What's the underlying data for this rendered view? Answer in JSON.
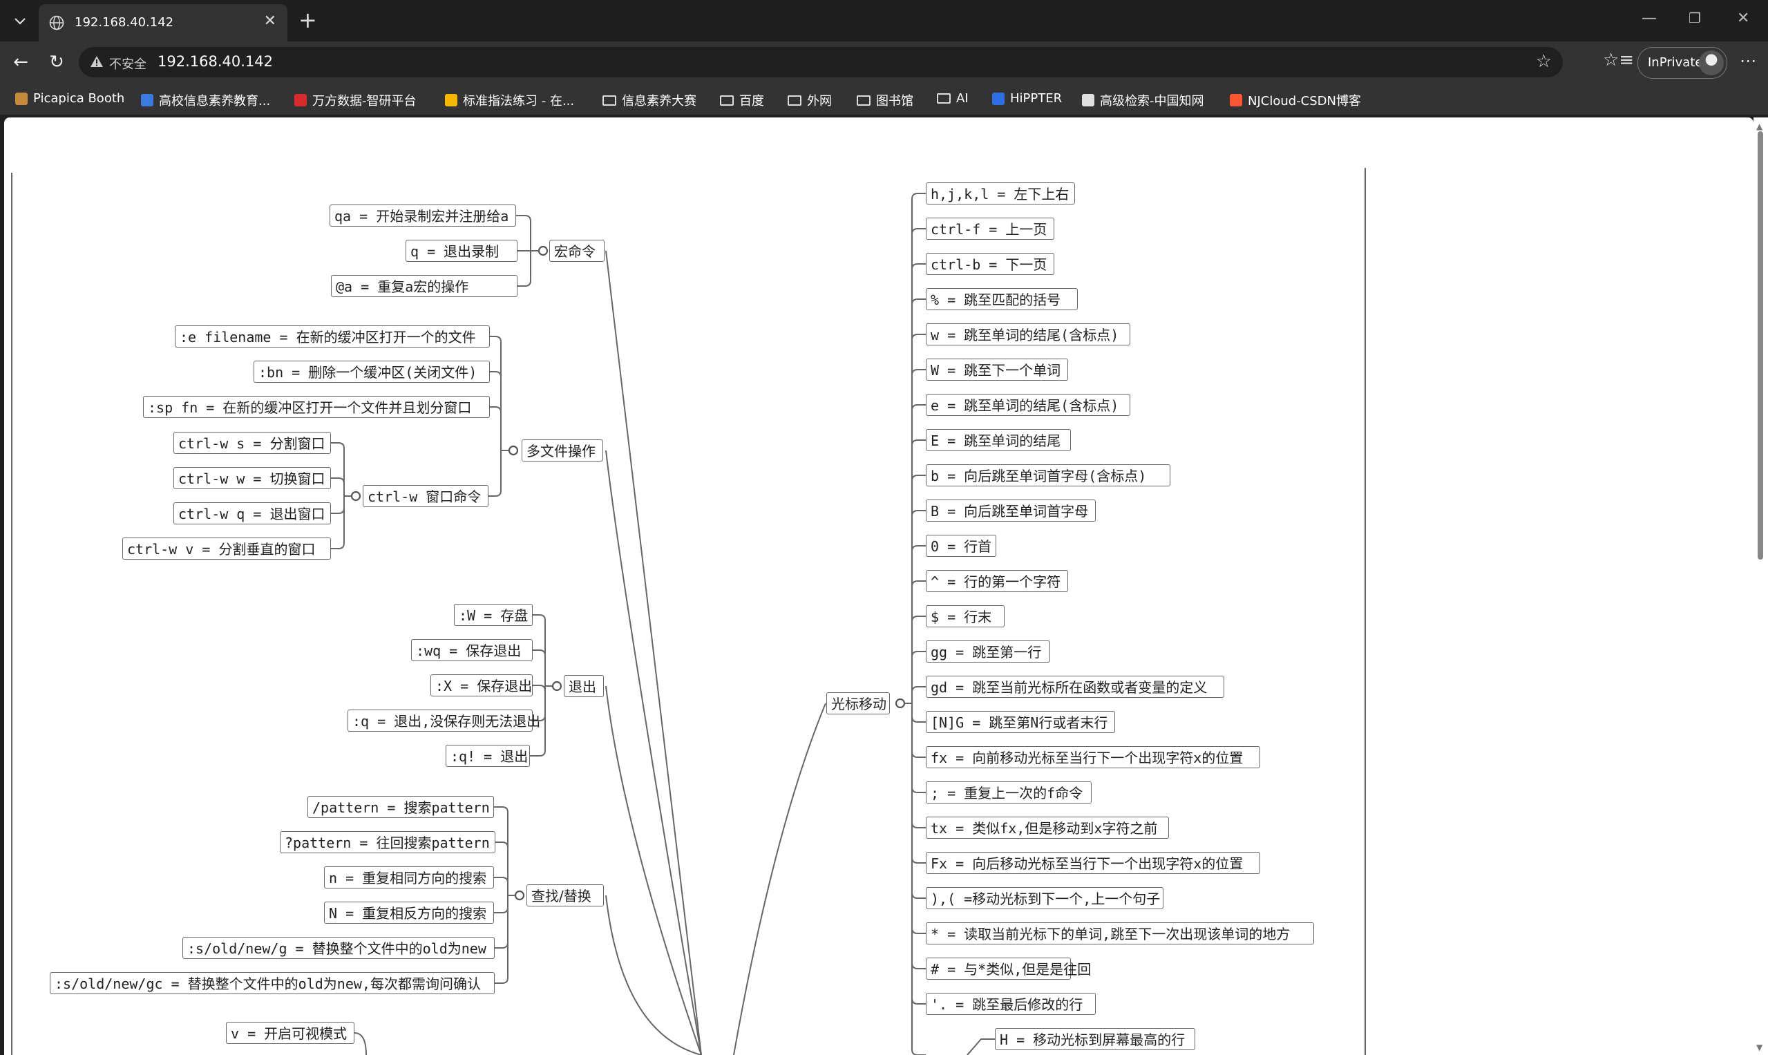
{
  "browser": {
    "tab_title": "192.168.40.142",
    "address_insecure_label": "不安全",
    "address_url": "192.168.40.142",
    "inprivate_label": "InPrivate",
    "bookmarks": [
      {
        "label": "Picapica Booth",
        "icon": "picapica-icon",
        "color": "#c68a3a"
      },
      {
        "label": "高校信息素养教育...",
        "icon": "z-logo-icon",
        "color": "#3b7be0"
      },
      {
        "label": "万方数据-智研平台",
        "icon": "wanfang-icon",
        "color": "#d92b2b"
      },
      {
        "label": "标准指法练习 - 在...",
        "icon": "emoji-icon",
        "color": "#f5b700"
      },
      {
        "label": "信息素养大赛",
        "icon": "folder-icon",
        "color": ""
      },
      {
        "label": "百度",
        "icon": "folder-icon",
        "color": ""
      },
      {
        "label": "外网",
        "icon": "folder-icon",
        "color": ""
      },
      {
        "label": "图书馆",
        "icon": "folder-icon",
        "color": ""
      },
      {
        "label": "AI",
        "icon": "folder-icon",
        "color": ""
      },
      {
        "label": "HiPPTER",
        "icon": "p-logo-icon",
        "color": "#2f6fe4"
      },
      {
        "label": "高级检索-中国知网",
        "icon": "cnki-icon",
        "color": "#e0e0e0"
      },
      {
        "label": "NJCloud-CSDN博客",
        "icon": "csdn-icon",
        "color": "#fc5531"
      }
    ]
  },
  "mindmap": {
    "groups": {
      "macro": "宏命令",
      "multifile": "多文件操作",
      "window": "ctrl-w 窗口命令",
      "quit": "退出",
      "search": "查找/替换",
      "cursor": "光标移动"
    },
    "macro_items": [
      "qa = 开始录制宏并注册给a",
      "q = 退出录制",
      "@a = 重复a宏的操作"
    ],
    "multifile_items": [
      ":e filename = 在新的缓冲区打开一个的文件",
      ":bn = 删除一个缓冲区(关闭文件)",
      ":sp fn = 在新的缓冲区打开一个文件并且划分窗口"
    ],
    "window_items": [
      "ctrl-w s = 分割窗口",
      "ctrl-w w = 切换窗口",
      "ctrl-w q = 退出窗口",
      "ctrl-w v = 分割垂直的窗口"
    ],
    "quit_items": [
      ":W = 存盘",
      ":wq = 保存退出",
      ":X = 保存退出",
      ":q = 退出,没保存则无法退出",
      ":q! = 退出"
    ],
    "search_items": [
      "/pattern = 搜索pattern",
      "?pattern = 往回搜索pattern",
      "n = 重复相同方向的搜索",
      "N = 重复相反方向的搜索",
      ":s/old/new/g = 替换整个文件中的old为new",
      ":s/old/new/gc = 替换整个文件中的old为new,每次都需询问确认"
    ],
    "visual_item": "v = 开启可视模式",
    "cursor_items": [
      "h,j,k,l = 左下上右",
      "ctrl-f = 上一页",
      "ctrl-b = 下一页",
      "% = 跳至匹配的括号",
      "w = 跳至单词的结尾(含标点)",
      "W = 跳至下一个单词",
      "e = 跳至单词的结尾(含标点)",
      "E = 跳至单词的结尾",
      "b = 向后跳至单词首字母(含标点)",
      "B = 向后跳至单词首字母",
      "0 = 行首",
      "^ = 行的第一个字符",
      "$ = 行末",
      "gg = 跳至第一行",
      "gd = 跳至当前光标所在函数或者变量的定义",
      "[N]G = 跳至第N行或者末行",
      "fx = 向前移动光标至当行下一个出现字符x的位置",
      "; = 重复上一次的f命令",
      "tx = 类似fx,但是移动到x字符之前",
      "Fx = 向后移动光标至当行下一个出现字符x的位置",
      "),( =移动光标到下一个,上一个句子",
      "* = 读取当前光标下的单词,跳至下一次出现该单词的地方",
      "# = 与*类似,但是是往回",
      "'. = 跳至最后修改的行"
    ],
    "cursor_sub_item": "H = 移动光标到屏幕最高的行"
  }
}
